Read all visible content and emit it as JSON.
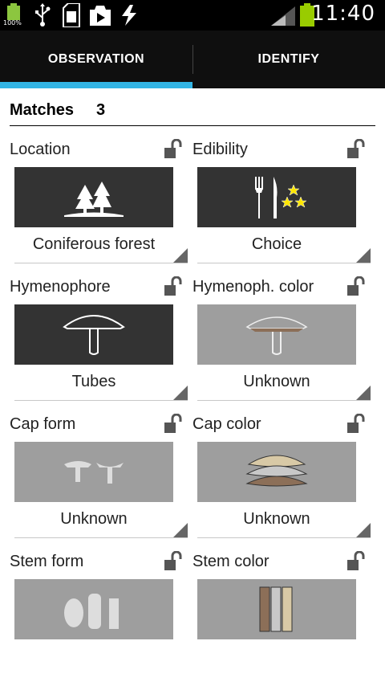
{
  "status_bar": {
    "battery_small_text": "100%",
    "time": "11:40",
    "icons": [
      "battery-full-icon",
      "usb-icon",
      "sd-card-icon",
      "play-store-icon",
      "sync-icon",
      "signal-icon",
      "battery-icon"
    ]
  },
  "tabs": [
    {
      "label": "OBSERVATION",
      "selected": true
    },
    {
      "label": "IDENTIFY",
      "selected": false
    }
  ],
  "colors": {
    "accent": "#33b5e5",
    "tab_bg": "#0f0f0f",
    "tile_dark": "#333333",
    "tile_light": "#9e9e9e"
  },
  "matches": {
    "label": "Matches",
    "count": "3"
  },
  "fields": [
    {
      "label": "Location",
      "value": "Coniferous forest",
      "icon": "coniferous-forest-icon"
    },
    {
      "label": "Edibility",
      "value": "Choice",
      "icon": "fork-knife-stars-icon"
    },
    {
      "label": "Hymenophore",
      "value": "Tubes",
      "icon": "mushroom-tubes-icon"
    },
    {
      "label": "Hymenoph. color",
      "value": "Unknown",
      "icon": "mushroom-color-icon"
    },
    {
      "label": "Cap form",
      "value": "Unknown",
      "icon": "cap-form-icon"
    },
    {
      "label": "Cap color",
      "value": "Unknown",
      "icon": "cap-color-icon"
    },
    {
      "label": "Stem form",
      "value": "",
      "icon": "stem-form-icon"
    },
    {
      "label": "Stem color",
      "value": "",
      "icon": "stem-color-icon"
    }
  ]
}
